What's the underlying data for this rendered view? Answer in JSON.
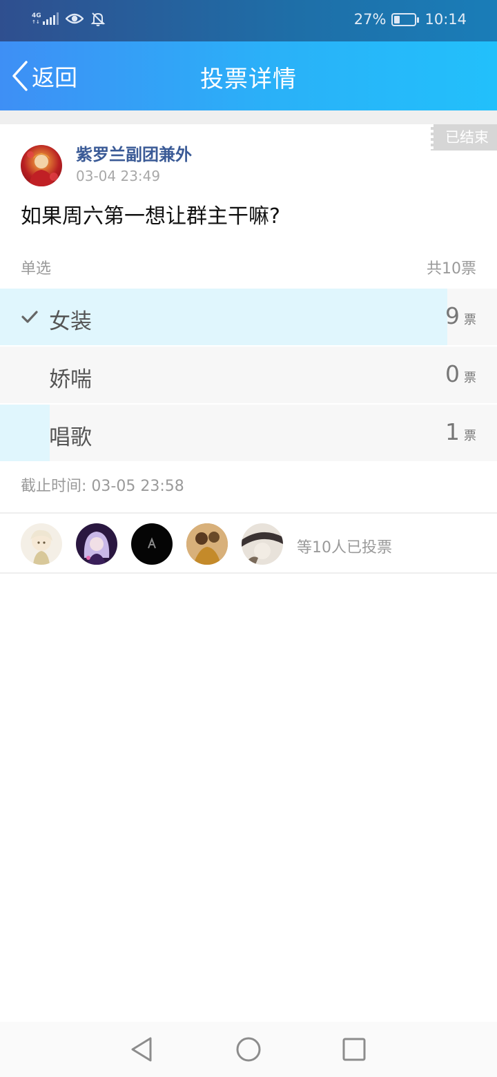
{
  "status_bar": {
    "network_label": "4G",
    "battery": "27%",
    "battery_level": 0.27,
    "time": "10:14",
    "icons": [
      "signal-icon",
      "eye-icon",
      "bell-off-icon",
      "battery-icon"
    ]
  },
  "header": {
    "back_label": "返回",
    "title": "投票详情"
  },
  "post": {
    "author": "紫罗兰副团兼外",
    "time": "03-04 23:49",
    "status_badge": "已结束",
    "question": "如果周六第一想让群主干嘛?"
  },
  "poll": {
    "type": "单选",
    "total": "共10票",
    "unit": "票",
    "options": [
      {
        "label": "女装",
        "count": "9",
        "fraction": 0.9,
        "selected": true
      },
      {
        "label": "娇喘",
        "count": "0",
        "fraction": 0.0,
        "selected": false
      },
      {
        "label": "唱歌",
        "count": "1",
        "fraction": 0.1,
        "selected": false
      }
    ],
    "deadline": "截止时间: 03-05 23:58"
  },
  "voters": {
    "summary": "等10人已投票",
    "count_shown": 5
  },
  "colors": {
    "accent": "#2ab1f8",
    "bar_fill": "#e0f6fd",
    "author": "#3a5a96"
  }
}
